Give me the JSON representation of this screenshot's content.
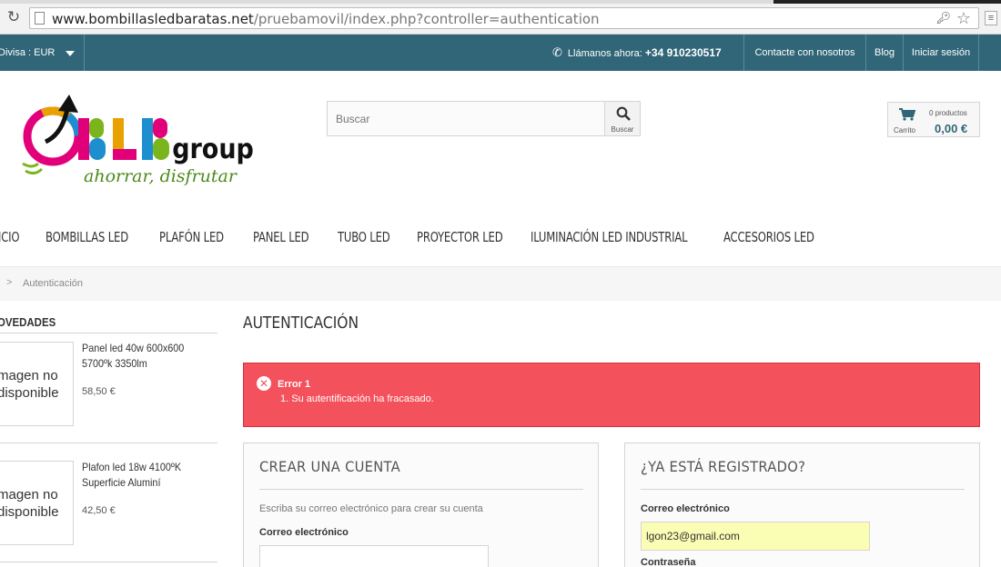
{
  "browser": {
    "reload_icon": "reload-icon",
    "url_host": "www.bombillasledbaratas.net",
    "url_path": "/pruebamovil/index.php?controller=authentication"
  },
  "topbar": {
    "currency_label": "Divisa : EUR",
    "call_label": "Llámanos ahora:",
    "phone": "+34 910230517",
    "links": [
      "Contacte con nosotros",
      "Blog",
      "Iniciar sesión"
    ]
  },
  "header": {
    "search_placeholder": "Buscar",
    "search_button": "Buscar",
    "cart_label": "Carrito",
    "cart_count": "0 productos",
    "cart_total": "0,00 €"
  },
  "menu": [
    "ICIO",
    "BOMBILLAS LED",
    "PLAFÓN LED",
    "PANEL LED",
    "TUBO LED",
    "PROYECTOR LED",
    "ILUMINACIÓN LED INDUSTRIAL",
    "ACCESORIOS LED"
  ],
  "breadcrumb": {
    "separator": ">",
    "current": "Autenticación"
  },
  "sidebar": {
    "title": "OVEDADES",
    "products": [
      {
        "image_line1": "magen no",
        "image_line2": "disponible",
        "name": "Panel led 40w 600x600 5700ºk 3350lm",
        "price": "58,50 €"
      },
      {
        "image_line1": "magen no",
        "image_line2": "disponible",
        "name": "Plafon led 18w 4100ºK Superficie Aluminí",
        "price": "42,50 €"
      }
    ]
  },
  "main": {
    "title": "AUTENTICACIÓN",
    "error_title": "Error 1",
    "error_message": "1. Su autentificación ha fracasado.",
    "create": {
      "heading": "CREAR UNA CUENTA",
      "description": "Escriba su correo electrónico para crear su cuenta",
      "email_label": "Correo electrónico",
      "email_value": ""
    },
    "login": {
      "heading": "¿YA ESTÁ REGISTRADO?",
      "email_label": "Correo electrónico",
      "email_value": "lgon23@gmail.com",
      "password_label": "Contraseña"
    }
  },
  "colors": {
    "topbar": "#306677",
    "error": "#f3515c",
    "autofill": "#fafdb4"
  }
}
